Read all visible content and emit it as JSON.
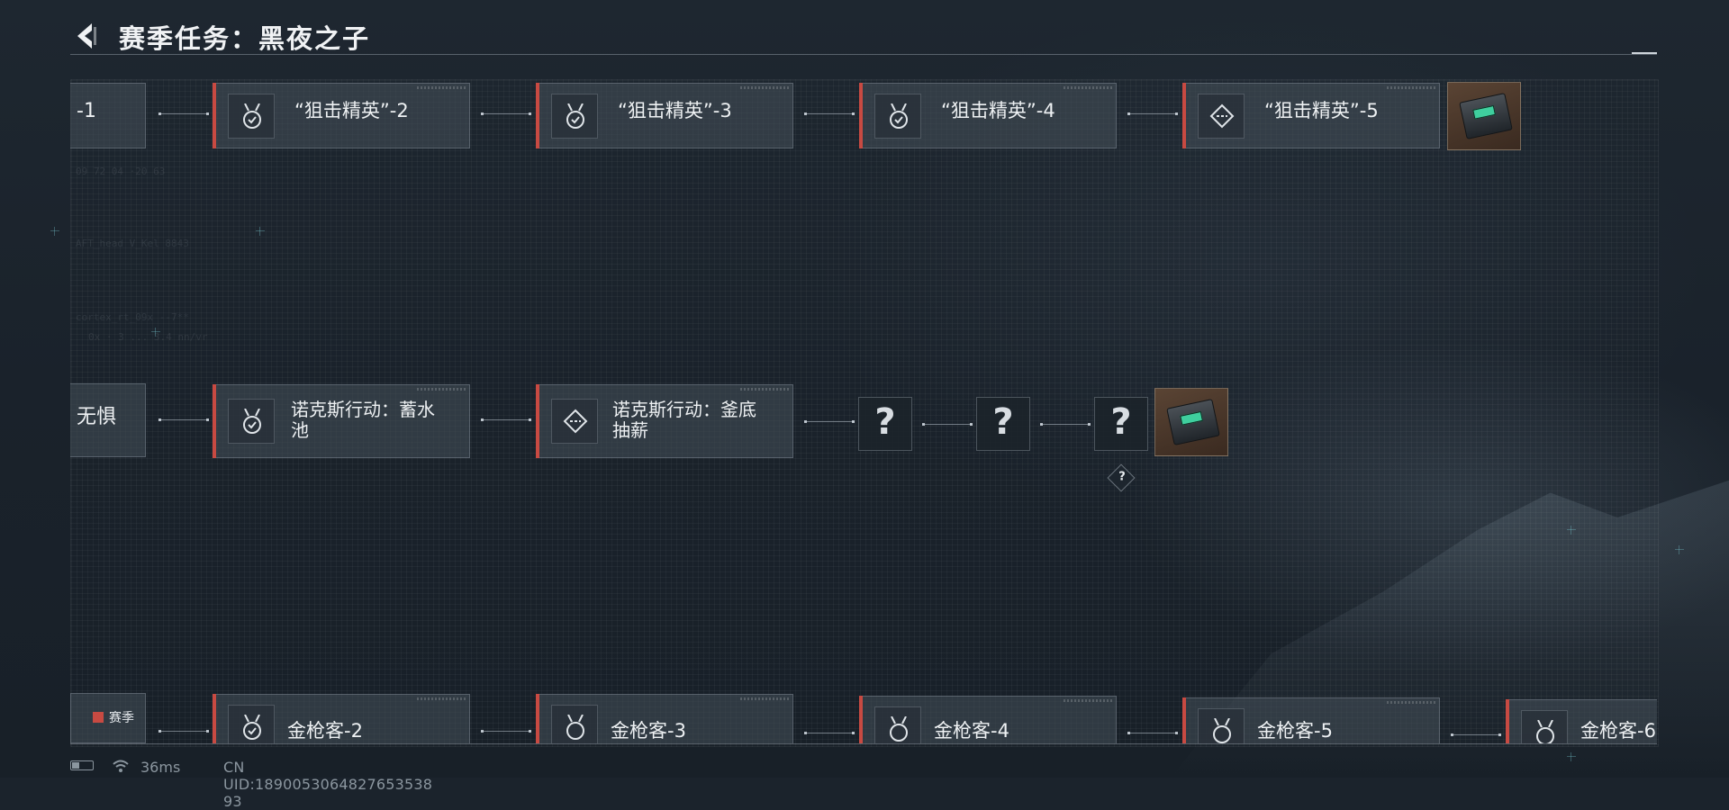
{
  "header": {
    "title": "赛季任务：黑夜之子"
  },
  "rows": {
    "top": {
      "stub": "-1",
      "nodes": [
        {
          "label": "“狙击精英”-2",
          "icon": "medal-check-icon"
        },
        {
          "label": "“狙击精英”-3",
          "icon": "medal-check-icon"
        },
        {
          "label": "“狙击精英”-4",
          "icon": "medal-check-icon"
        },
        {
          "label": "“狙击精英”-5",
          "icon": "diamond-target-icon"
        }
      ]
    },
    "middle": {
      "stub": "无惧",
      "nodes": [
        {
          "label": "诺克斯行动：蓄水池",
          "icon": "medal-check-icon"
        },
        {
          "label": "诺克斯行动：釜底抽薪",
          "icon": "diamond-target-icon"
        }
      ],
      "mystery": [
        "?",
        "?",
        "?"
      ],
      "hint": "?"
    },
    "bottom": {
      "tag": "赛季",
      "nodes": [
        {
          "label": "金枪客-2",
          "icon": "medal-check-icon"
        },
        {
          "label": "金枪客-3",
          "icon": "medal-icon"
        },
        {
          "label": "金枪客-4",
          "icon": "medal-icon"
        },
        {
          "label": "金枪客-5",
          "icon": "medal-icon"
        },
        {
          "label": "金枪客-6",
          "icon": "medal-icon"
        }
      ]
    }
  },
  "status": {
    "ping": "36ms",
    "uid": "CN UID:1890053064827653538​93"
  },
  "colors": {
    "accent": "#c84a42",
    "background": "#1b232c"
  }
}
